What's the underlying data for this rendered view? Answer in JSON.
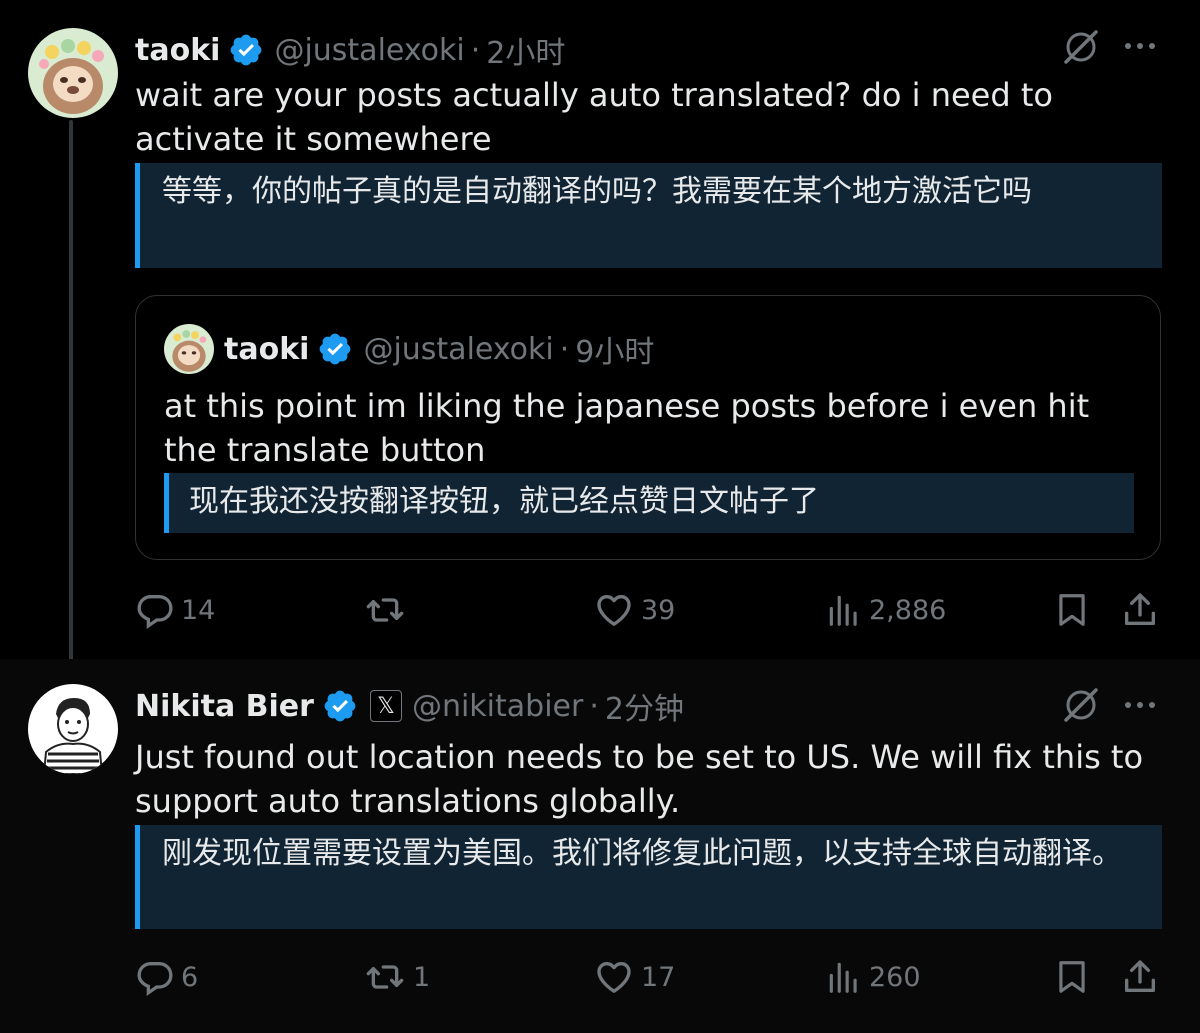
{
  "posts": [
    {
      "author_name": "taoki",
      "handle": "@justalexoki",
      "time": "2小时",
      "text": "wait are your posts actually auto translated? do i need to activate it somewhere",
      "translation": "等等，你的帖子真的是自动翻译的吗？我需要在某个地方激活它吗",
      "quoted_post": {
        "author_name": "taoki",
        "handle": "@justalexoki",
        "time": "9小时",
        "text": "at this point im liking the japanese posts before i even hit the translate button",
        "translation": "现在我还没按翻译按钮，就已经点赞日文帖子了"
      },
      "stats": {
        "replies": "14",
        "reposts": "",
        "likes": "39",
        "views": "2,886"
      }
    },
    {
      "author_name": "Nikita Bier",
      "affiliate_badge": "𝕏",
      "handle": "@nikitabier",
      "time": "2分钟",
      "text": "Just found out location needs to be set to US. We will fix this to support auto translations globally.",
      "translation": "刚发现位置需要设置为美国。我们将修复此问题，以支持全球自动翻译。",
      "stats": {
        "replies": "6",
        "reposts": "1",
        "likes": "17",
        "views": "260"
      }
    }
  ],
  "separator": "·",
  "colors": {
    "background": "#000000",
    "text_primary": "#e7e9ea",
    "text_secondary": "#71767b",
    "accent_blue": "#1d9bf0",
    "translation_bg": "#112433",
    "border": "#2f3336"
  },
  "icons": {
    "verified": "verified-badge-icon",
    "grok": "grok-icon",
    "more": "more-icon",
    "reply": "reply-icon",
    "repost": "repost-icon",
    "like": "like-icon",
    "views": "views-icon",
    "bookmark": "bookmark-icon",
    "share": "share-icon"
  }
}
